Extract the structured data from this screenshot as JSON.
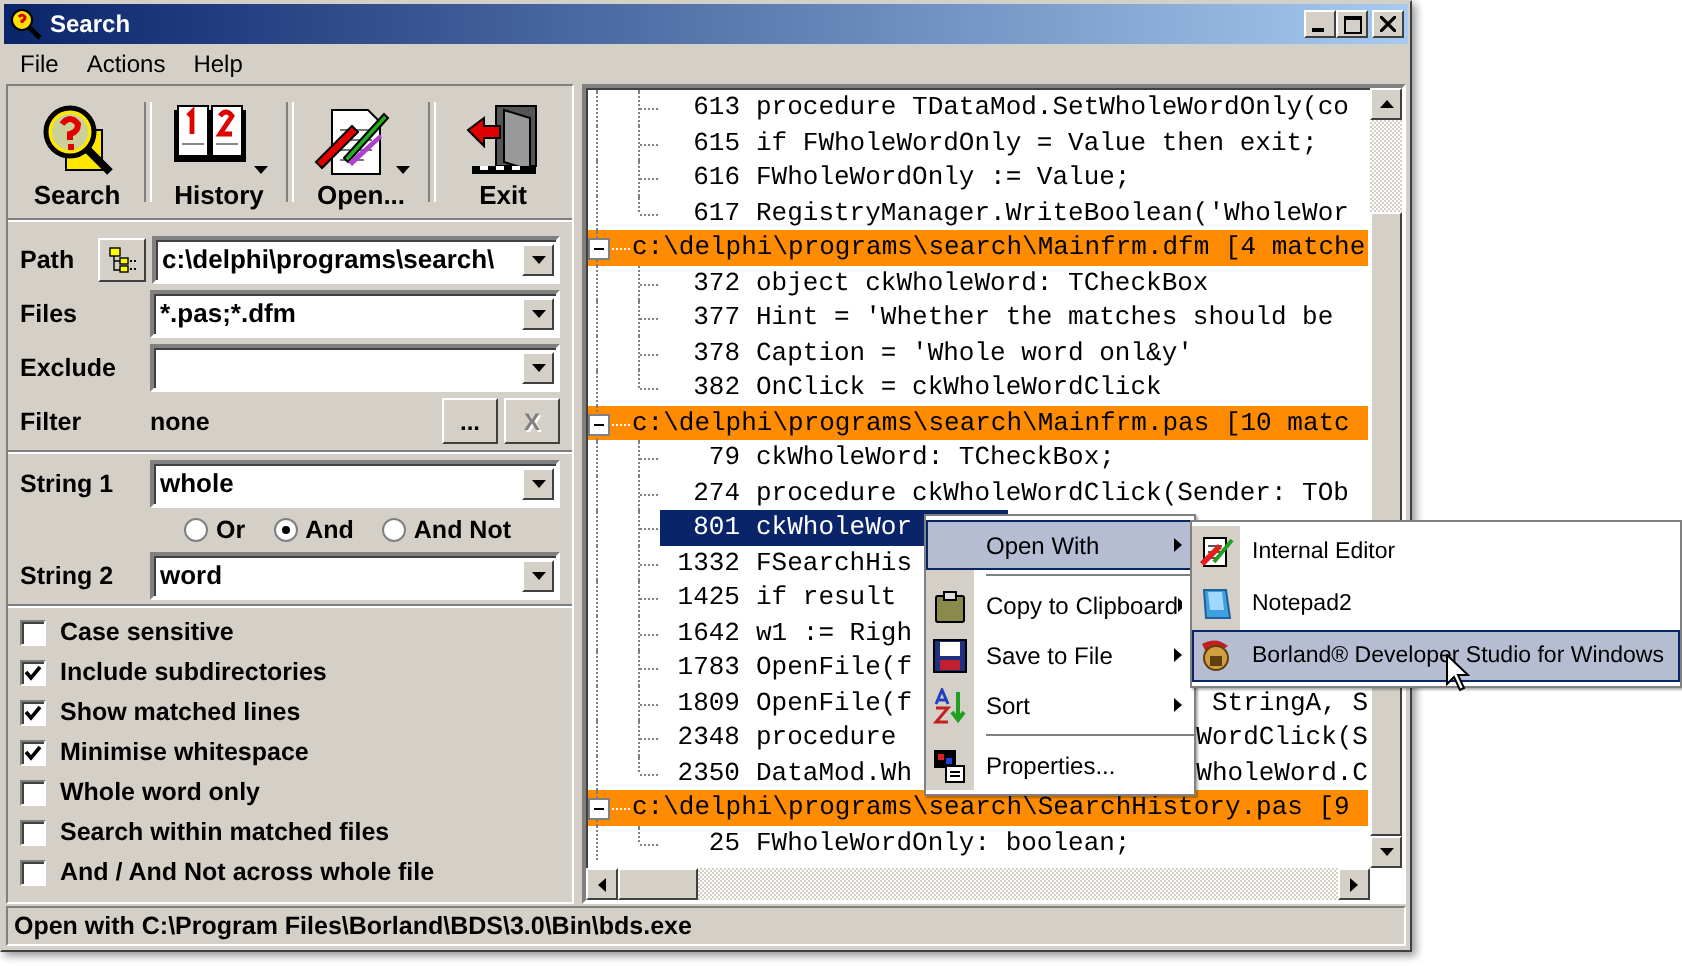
{
  "window": {
    "title": "Search"
  },
  "menu": [
    {
      "label": "File"
    },
    {
      "label": "Actions"
    },
    {
      "label": "Help"
    }
  ],
  "toolbar": [
    {
      "kind": "search",
      "label": "Search",
      "dropdown": false
    },
    {
      "kind": "history",
      "label": "History",
      "dropdown": true
    },
    {
      "kind": "open",
      "label": "Open...",
      "dropdown": true
    },
    {
      "kind": "exit",
      "label": "Exit",
      "dropdown": false
    }
  ],
  "form": {
    "path": {
      "label": "Path",
      "value": "c:\\delphi\\programs\\search\\"
    },
    "files": {
      "label": "Files",
      "value": "*.pas;*.dfm"
    },
    "exclude": {
      "label": "Exclude"
    },
    "filter": {
      "label": "Filter",
      "value": "none",
      "browse": "...",
      "clear": "X",
      "clear_disabled": true
    },
    "string1": {
      "label": "String 1",
      "value": "whole"
    },
    "operators": [
      {
        "label": "Or",
        "selected": false
      },
      {
        "label": "And",
        "selected": true
      },
      {
        "label": "And Not",
        "selected": false
      }
    ],
    "string2": {
      "label": "String 2",
      "value": "word"
    }
  },
  "options": [
    {
      "label": "Case sensitive",
      "checked": false
    },
    {
      "label": "Include subdirectories",
      "checked": true
    },
    {
      "label": "Show matched lines",
      "checked": true
    },
    {
      "label": "Minimise whitespace",
      "checked": true
    },
    {
      "label": "Whole word only",
      "checked": false
    },
    {
      "label": "Search within matched files",
      "checked": false
    },
    {
      "label": "And / And Not across whole file",
      "checked": false
    }
  ],
  "results": [
    {
      "children": [
        {
          "num": "613",
          "text": "procedure TDataMod.SetWholeWordOnly(co",
          "selected": false
        },
        {
          "num": "615",
          "text": "if FWholeWordOnly = Value then exit;",
          "selected": false
        },
        {
          "num": "616",
          "text": "FWholeWordOnly := Value;",
          "selected": false
        },
        {
          "num": "617",
          "text": "RegistryManager.WriteBoolean('WholeWor",
          "selected": false
        }
      ]
    },
    {
      "label": "c:\\delphi\\programs\\search\\Mainfrm.dfm [4 matche",
      "expanded": true,
      "children": [
        {
          "num": "372",
          "text": "object ckWholeWord: TCheckBox",
          "selected": false
        },
        {
          "num": "377",
          "text": "Hint = 'Whether the matches should be",
          "selected": false
        },
        {
          "num": "378",
          "text": "Caption = 'Whole word onl&y'",
          "selected": false
        },
        {
          "num": "382",
          "text": "OnClick = ckWholeWordClick",
          "selected": false
        }
      ]
    },
    {
      "label": "c:\\delphi\\programs\\search\\Mainfrm.pas [10 matc",
      "expanded": true,
      "children": [
        {
          "num": "79",
          "text": "ckWholeWord: TCheckBox;",
          "selected": false
        },
        {
          "num": "274",
          "text": "procedure ckWholeWordClick(Sender: TOb",
          "selected": false
        },
        {
          "num": "801",
          "text": "ckWholeWor",
          "selected": true
        },
        {
          "num": "1332",
          "text": "FSearchHis",
          "selected": false
        },
        {
          "num": "1425",
          "text": "if result",
          "selected": false
        },
        {
          "num": "1642",
          "text": "w1 := Righ",
          "selected": false
        },
        {
          "num": "1783",
          "text": "OpenFile(f",
          "selected": false
        },
        {
          "num": "1809",
          "text": "OpenFile(f",
          "tail": "StringA, S",
          "selected": false
        },
        {
          "num": "2348",
          "text": "procedure",
          "tail": "WordClick(S",
          "selected": false
        },
        {
          "num": "2350",
          "text": "DataMod.Wh",
          "tail": "WholeWord.C",
          "selected": false
        }
      ]
    },
    {
      "label": "c:\\delphi\\programs\\search\\SearchHistory.pas [9",
      "expanded": true,
      "children": [
        {
          "num": "25",
          "text": "FWholeWordOnly: boolean;",
          "selected": false
        }
      ]
    }
  ],
  "context_menu": [
    {
      "kind": "none",
      "label": "Open With",
      "submenu": true,
      "selected": true
    },
    {
      "kind": "separator"
    },
    {
      "kind": "clipboard",
      "label": "Copy to Clipboard",
      "submenu": true,
      "selected": false
    },
    {
      "kind": "floppy",
      "label": "Save to File",
      "submenu": true,
      "selected": false
    },
    {
      "kind": "sort",
      "label": "Sort",
      "submenu": true,
      "selected": false
    },
    {
      "kind": "separator"
    },
    {
      "kind": "properties",
      "label": "Properties...",
      "submenu": false,
      "selected": false
    }
  ],
  "submenu": [
    {
      "kind": "editor",
      "label": "Internal Editor",
      "selected": false
    },
    {
      "kind": "notepad",
      "label": "Notepad2",
      "selected": false
    },
    {
      "kind": "helmet",
      "label": "Borland® Developer Studio for Windows",
      "selected": true
    }
  ],
  "status_bar": "Open with C:\\Program Files\\Borland\\BDS\\3.0\\Bin\\bds.exe"
}
